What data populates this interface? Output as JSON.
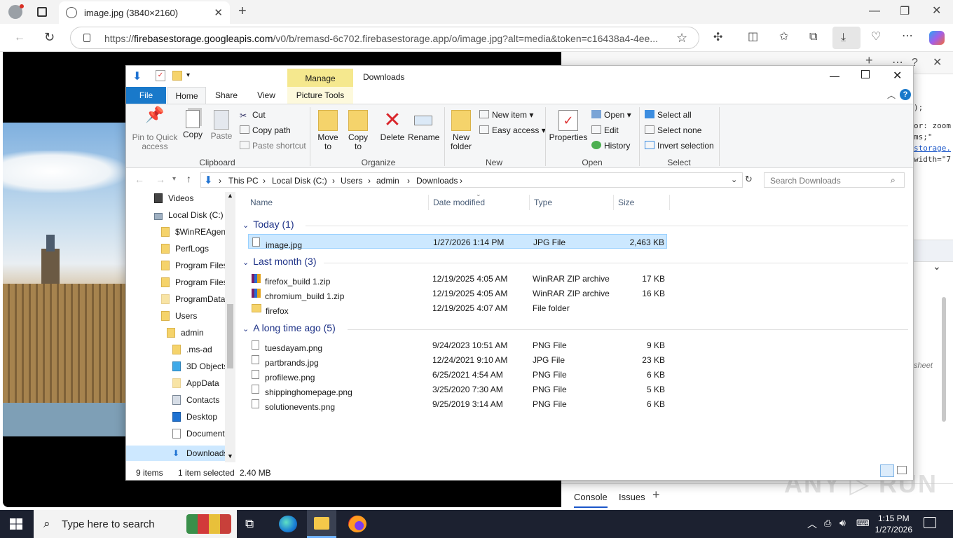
{
  "browser": {
    "tab_title": "image.jpg (3840×2160)",
    "url_prefix": "https://",
    "url_host": "firebasestorage.googleapis.com",
    "url_rest": "/v0/b/remasd-6c702.firebasestorage.app/o/image.jpg?alt=media&token=c16438a4-4ee..."
  },
  "devtools": {
    "code_lines": [
      ");",
      "or: zoom",
      "ms;\"",
      "storage.",
      "width=\"7"
    ],
    "sheet_label": "sheet",
    "tabs": [
      "Console",
      "Issues"
    ]
  },
  "explorer": {
    "title": "Downloads",
    "manage_tab": "Manage",
    "ribbon_tabs": [
      "File",
      "Home",
      "Share",
      "View",
      "Picture Tools"
    ],
    "clipboard": {
      "pin": "Pin to Quick access",
      "copy": "Copy",
      "paste": "Paste",
      "cut": "Cut",
      "copy_path": "Copy path",
      "paste_shortcut": "Paste shortcut",
      "label": "Clipboard"
    },
    "organize": {
      "move_to": "Move to",
      "copy_to": "Copy to",
      "delete": "Delete",
      "rename": "Rename",
      "label": "Organize"
    },
    "new": {
      "new_folder": "New folder",
      "new_item": "New item",
      "easy_access": "Easy access",
      "label": "New"
    },
    "open": {
      "properties": "Properties",
      "open": "Open",
      "edit": "Edit",
      "history": "History",
      "label": "Open"
    },
    "select": {
      "select_all": "Select all",
      "select_none": "Select none",
      "invert": "Invert selection",
      "label": "Select"
    },
    "breadcrumbs": [
      "This PC",
      "Local Disk (C:)",
      "Users",
      "admin",
      "Downloads"
    ],
    "search_placeholder": "Search Downloads",
    "tree": [
      "Videos",
      "Local Disk (C:)",
      "$WinREAgent",
      "PerfLogs",
      "Program Files",
      "Program Files",
      "ProgramData",
      "Users",
      "admin",
      ".ms-ad",
      "3D Objects",
      "AppData",
      "Contacts",
      "Desktop",
      "Documents",
      "Downloads"
    ],
    "columns": [
      "Name",
      "Date modified",
      "Type",
      "Size"
    ],
    "groups": [
      {
        "label": "Today (1)",
        "files": [
          {
            "name": "image.jpg",
            "date": "1/27/2026 1:14 PM",
            "type": "JPG File",
            "size": "2,463 KB",
            "icon": "image-file-icon",
            "selected": true
          }
        ]
      },
      {
        "label": "Last month (3)",
        "files": [
          {
            "name": "firefox_build 1.zip",
            "date": "12/19/2025 4:05 AM",
            "type": "WinRAR ZIP archive",
            "size": "17 KB",
            "icon": "zip-archive-icon"
          },
          {
            "name": "chromium_build 1.zip",
            "date": "12/19/2025 4:05 AM",
            "type": "WinRAR ZIP archive",
            "size": "16 KB",
            "icon": "zip-archive-icon"
          },
          {
            "name": "firefox",
            "date": "12/19/2025 4:07 AM",
            "type": "File folder",
            "size": "",
            "icon": "folder-icon"
          }
        ]
      },
      {
        "label": "A long time ago (5)",
        "files": [
          {
            "name": "tuesdayam.png",
            "date": "9/24/2023 10:51 AM",
            "type": "PNG File",
            "size": "9 KB",
            "icon": "image-file-icon"
          },
          {
            "name": "partbrands.jpg",
            "date": "12/24/2021 9:10 AM",
            "type": "JPG File",
            "size": "23 KB",
            "icon": "image-file-icon"
          },
          {
            "name": "profilewe.png",
            "date": "6/25/2021 4:54 AM",
            "type": "PNG File",
            "size": "6 KB",
            "icon": "image-file-icon"
          },
          {
            "name": "shippinghomepage.png",
            "date": "3/25/2020 7:30 AM",
            "type": "PNG File",
            "size": "5 KB",
            "icon": "image-file-icon"
          },
          {
            "name": "solutionevents.png",
            "date": "9/25/2019 3:14 AM",
            "type": "PNG File",
            "size": "6 KB",
            "icon": "image-file-icon"
          }
        ]
      }
    ],
    "status": {
      "count": "9 items",
      "selected": "1 item selected",
      "size": "2.40 MB"
    }
  },
  "taskbar": {
    "search_placeholder": "Type here to search",
    "time": "1:15 PM",
    "date": "1/27/2026"
  }
}
